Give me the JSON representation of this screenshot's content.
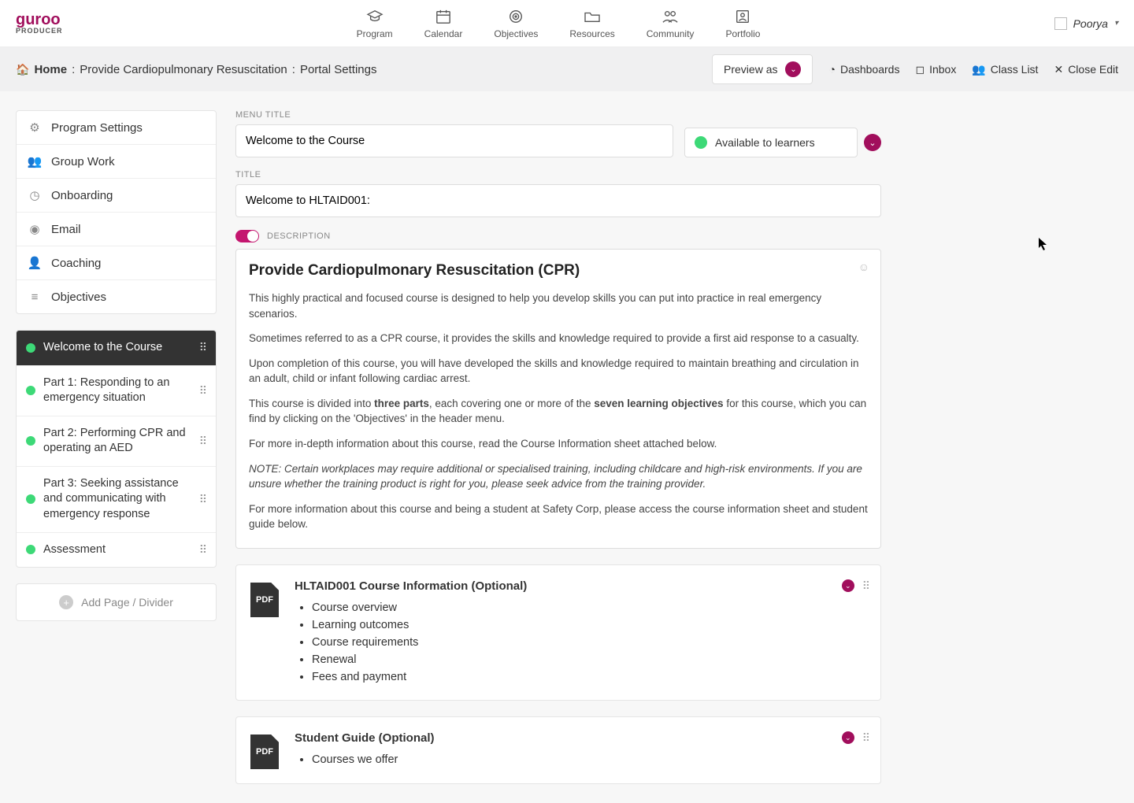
{
  "brand": {
    "name": "guroo",
    "sub": "PRODUCER"
  },
  "nav": [
    {
      "label": "Program"
    },
    {
      "label": "Calendar"
    },
    {
      "label": "Objectives"
    },
    {
      "label": "Resources"
    },
    {
      "label": "Community"
    },
    {
      "label": "Portfolio"
    }
  ],
  "user": {
    "name": "Poorya"
  },
  "breadcrumb": {
    "home": "Home",
    "sep": ":",
    "mid": "Provide Cardiopulmonary Resuscitation",
    "tail": "Portal Settings"
  },
  "actions": {
    "preview_as": "Preview as",
    "dashboards": "Dashboards",
    "inbox": "Inbox",
    "class_list": "Class List",
    "close_edit": "Close Edit"
  },
  "settings": [
    {
      "label": "Program Settings",
      "icon": "gears"
    },
    {
      "label": "Group Work",
      "icon": "users"
    },
    {
      "label": "Onboarding",
      "icon": "time"
    },
    {
      "label": "Email",
      "icon": "mail"
    },
    {
      "label": "Coaching",
      "icon": "coach"
    },
    {
      "label": "Objectives",
      "icon": "list"
    }
  ],
  "pages": [
    {
      "label": "Welcome to the Course",
      "active": true
    },
    {
      "label": "Part 1: Responding to an emergency situation"
    },
    {
      "label": "Part 2: Performing CPR and operating an AED"
    },
    {
      "label": "Part 3: Seeking assistance and communicating with emergency response"
    },
    {
      "label": "Assessment"
    }
  ],
  "add_page": "Add Page / Divider",
  "fields": {
    "menu_title_label": "MENU TITLE",
    "menu_title_value": "Welcome to the Course",
    "availability": "Available to learners",
    "title_label": "TITLE",
    "title_value": "Welcome to HLTAID001:",
    "description_label": "DESCRIPTION"
  },
  "description": {
    "heading": "Provide Cardiopulmonary Resuscitation (CPR)",
    "p1": "This highly practical and focused course is designed to help you develop skills you can put into practice in real emergency scenarios.",
    "p2": "Sometimes referred to as a CPR course, it provides the skills and knowledge required to provide a first aid response to a casualty.",
    "p3": "Upon completion of this course, you will have developed the skills and knowledge required to maintain breathing and circulation in an adult, child or infant following cardiac arrest.",
    "p4a": "This course is divided into ",
    "p4b": "three parts",
    "p4c": ", each covering one or more of the ",
    "p4d": "seven learning objectives",
    "p4e": " for this course, which you can find by clicking on the 'Objectives' in the header menu.",
    "p5": "For more in-depth information about this course, read the Course Information sheet attached below.",
    "p6": "NOTE: Certain workplaces may require additional or specialised training, including childcare and high-risk environments. If you are unsure whether the training product is right for you, please seek advice from the training provider.",
    "p7": "For more information about this course and being a student at Safety Corp, please access the course information sheet and student guide below."
  },
  "attachments": [
    {
      "title": "HLTAID001 Course Information (Optional)",
      "items": [
        "Course overview",
        "Learning outcomes",
        "Course requirements",
        "Renewal",
        "Fees and payment"
      ]
    },
    {
      "title": "Student Guide (Optional)",
      "items": [
        "Courses we offer"
      ]
    }
  ],
  "pdf_badge": "PDF"
}
